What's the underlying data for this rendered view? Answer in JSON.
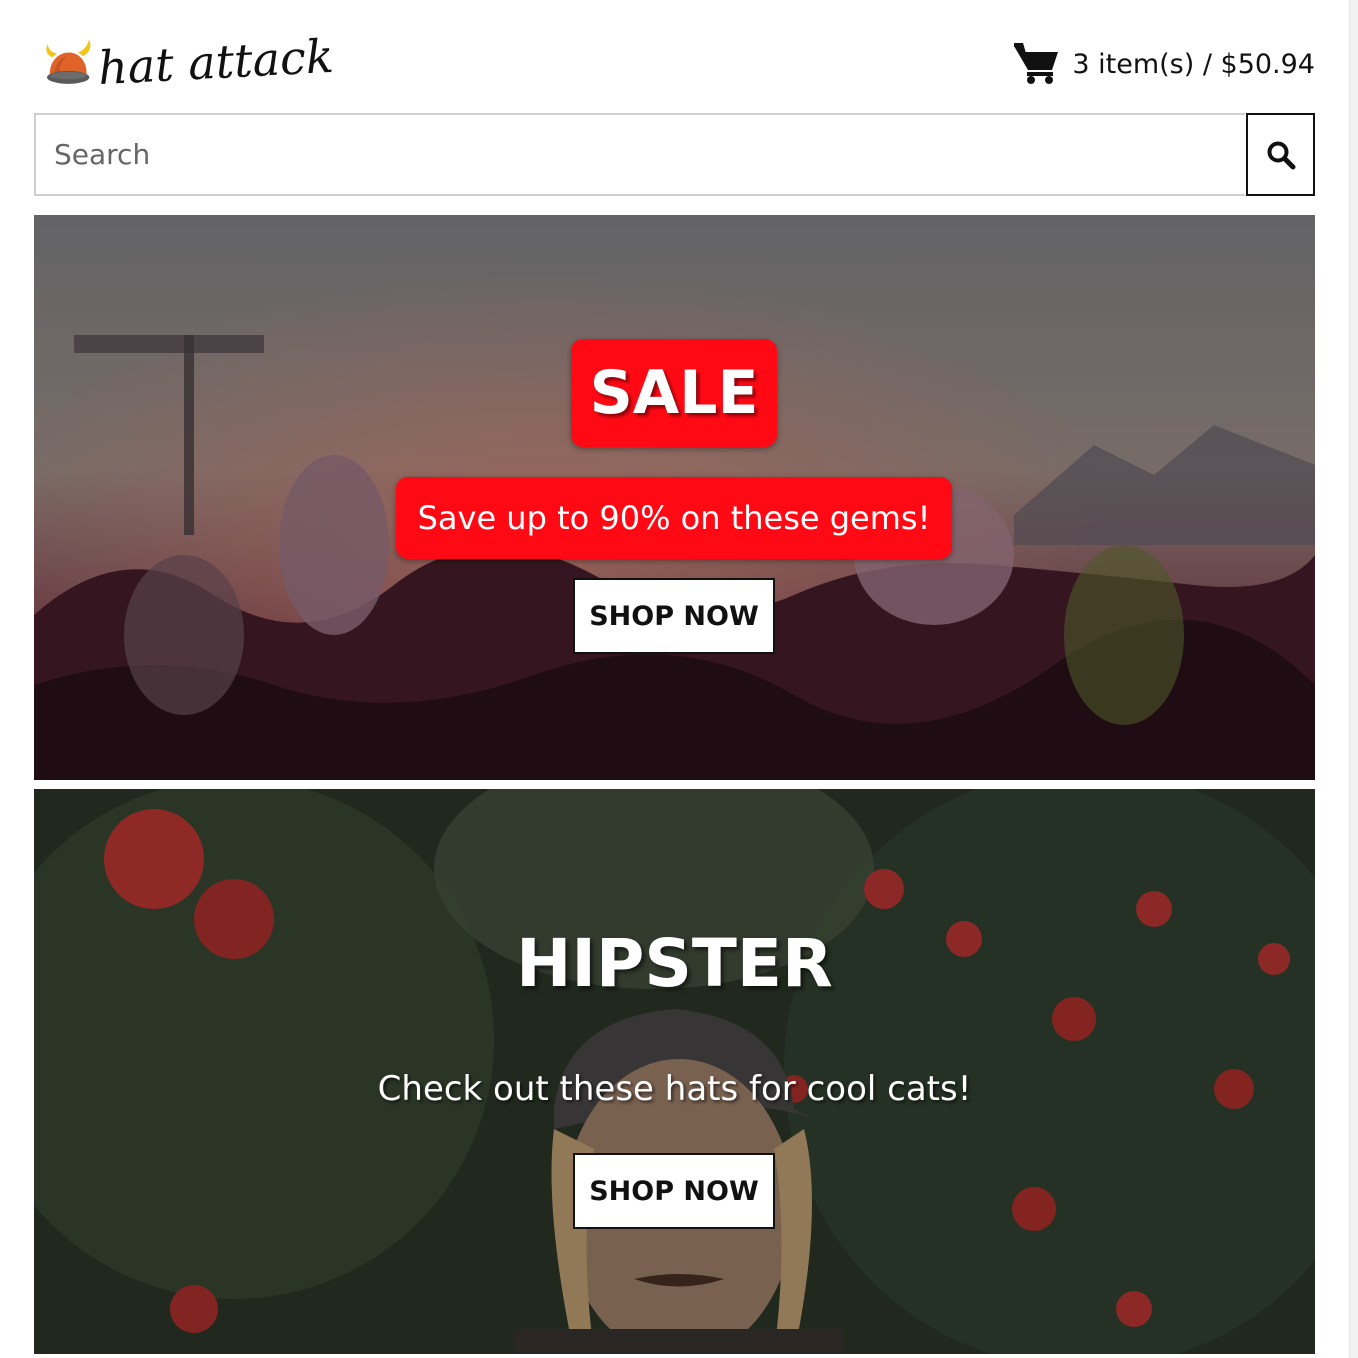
{
  "brand": {
    "name": "hat attack",
    "logo_icon": "viking-hat-icon"
  },
  "cart": {
    "icon": "shopping-cart-icon",
    "summary": "3 item(s) / $50.94"
  },
  "search": {
    "placeholder": "Search",
    "value": "",
    "button_icon": "search-icon"
  },
  "banners": [
    {
      "badge": "SALE",
      "subtitle": "Save up to 90% on these gems!",
      "button_label": "SHOP NOW",
      "accent": "#ff0a14"
    },
    {
      "title": "HIPSTER",
      "subtitle": "Check out these hats for cool cats!",
      "button_label": "SHOP NOW"
    }
  ]
}
